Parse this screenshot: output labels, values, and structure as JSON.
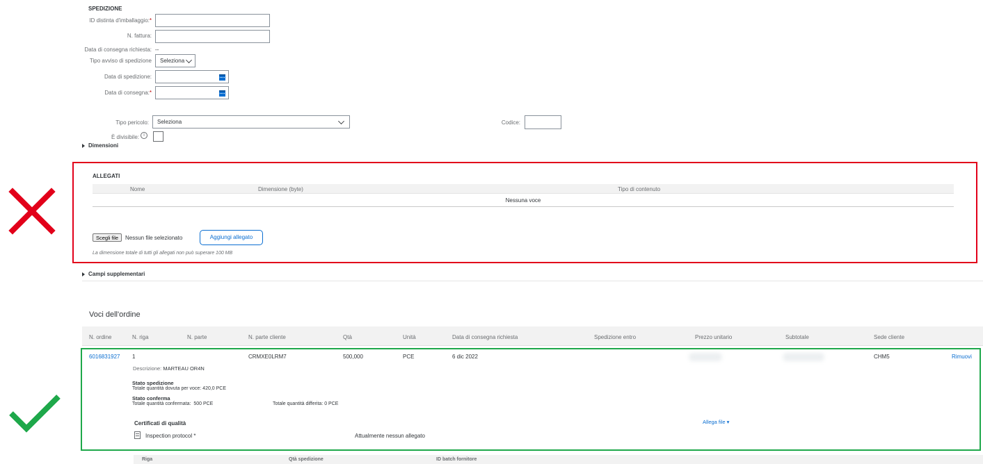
{
  "shipment": {
    "section_title": "SPEDIZIONE",
    "packing_slip_label": "ID distinta d'imballaggio:",
    "invoice_label": "N. fattura:",
    "requested_delivery_label": "Data di consegna richiesta:",
    "requested_delivery_value": "--",
    "notice_type_label": "Tipo avviso di spedizione",
    "notice_type_value": "Seleziona",
    "ship_date_label": "Data di spedizione:",
    "delivery_date_label": "Data di consegna:",
    "required_mark": "*",
    "hazard_type_label": "Tipo pericolo:",
    "hazard_type_value": "Seleziona",
    "code_label": "Codice:",
    "divisible_label": "È divisibile:",
    "dimensions_label": "Dimensioni"
  },
  "attachments": {
    "title": "ALLEGATI",
    "columns": [
      "Nome",
      "Dimensione (byte)",
      "Tipo di contenuto"
    ],
    "empty_text": "Nessuna voce",
    "choose_file_label": "Scegli file",
    "no_file_text": "Nessun file selezionato",
    "add_button": "Aggiungi allegato",
    "note": "La dimensione totale di tutti gli allegati non può superare 100 MB"
  },
  "supplementary_label": "Campi supplementari",
  "order_items": {
    "title": "Voci dell'ordine",
    "columns": [
      "N. ordine",
      "N. riga",
      "N. parte",
      "N. parte cliente",
      "Qtà",
      "Unità",
      "Data di consegna richiesta",
      "Spedizione entro",
      "Prezzo unitario",
      "Subtotale",
      "Sede cliente"
    ],
    "row": {
      "order_no": "6016831927",
      "line_no": "1",
      "customer_part": "CRMXE0LRM7",
      "qty": "500,000",
      "unit": "PCE",
      "delivery_date": "6 dic 2022",
      "site": "CHM5",
      "remove": "Rimuovi",
      "description_label": "Descrizione:",
      "description_value": "MARTEAU OR4N",
      "ship_status_title": "Stato spedizione",
      "ship_status_text": "Totale quantità dovuta per voce: 420,0 PCE",
      "confirm_status_title": "Stato conferma",
      "confirmed_text": "Totale quantità confermata:  500 PCE",
      "deferred_text": "Totale quantità differita: 0 PCE",
      "quality_title": "Certificati di qualità",
      "attach_file": "Allega file",
      "inspection_label": "Inspection protocol *",
      "no_attachment": "Attualmente nessun allegato"
    },
    "sub_columns": [
      "Riga",
      "Qtà spedizione",
      "ID batch fornitore"
    ]
  },
  "colors": {
    "accent": "#0a6ed1",
    "error_frame": "#e2001a",
    "ok_frame": "#1ea84a"
  }
}
